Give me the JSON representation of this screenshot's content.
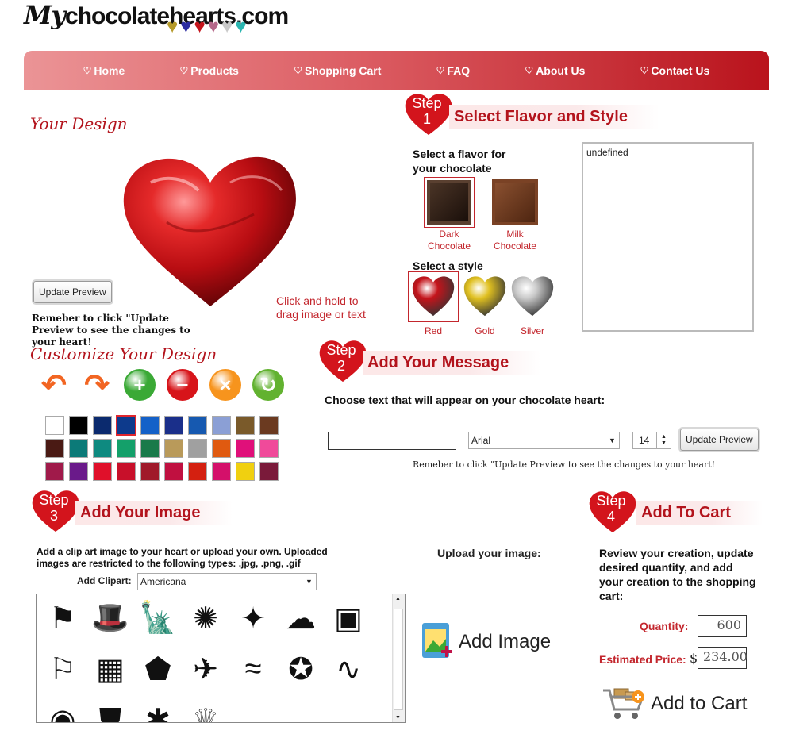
{
  "header": {
    "logo_prefix": "My",
    "logo_text": "chocolatehearts.com",
    "logo_hearts": [
      "#b59a2a",
      "#2c2ca0",
      "#c4141b",
      "#b5688a",
      "#c8c8c8",
      "#2bb5b0"
    ]
  },
  "nav": {
    "items": [
      {
        "label": "Home",
        "icon": "heart-icon"
      },
      {
        "label": "Products",
        "icon": "heart-icon"
      },
      {
        "label": "Shopping Cart",
        "icon": "heart-icon"
      },
      {
        "label": "FAQ",
        "icon": "heart-icon"
      },
      {
        "label": "About Us",
        "icon": "heart-icon"
      },
      {
        "label": "Contact Us",
        "icon": "heart-icon"
      }
    ]
  },
  "design": {
    "title": "Your Design",
    "update_button": "Update Preview",
    "reminder": "Remeber to click \"Update Preview to see the changes to your heart!",
    "drag_hint": "Click and hold to drag image or text"
  },
  "customize": {
    "title": "Customize Your Design",
    "tools": [
      {
        "icon": "rotate-left-icon",
        "color": "#f26522"
      },
      {
        "icon": "rotate-right-icon",
        "color": "#f26522"
      },
      {
        "icon": "zoom-in-icon",
        "color": "#3aa935"
      },
      {
        "icon": "zoom-out-icon",
        "color": "#d7141a"
      },
      {
        "icon": "delete-icon",
        "color": "#f7941d"
      },
      {
        "icon": "refresh-icon",
        "color": "#62b230"
      }
    ],
    "swatches": [
      "#ffffff",
      "#000000",
      "#0b2a6e",
      "#0d3a8c",
      "#1461c8",
      "#1a2f8a",
      "#1659b0",
      "#8b9fd5",
      "#7a5a2a",
      "#6b3a20",
      "#4a1a14",
      "#0c7a78",
      "#0e8a80",
      "#14a06a",
      "#1a7a4a",
      "#b99a5a",
      "#a0a0a0",
      "#e05a10",
      "#e0107a",
      "#f04a9a",
      "#a01a4a",
      "#6a1a8a",
      "#e0102a",
      "#c8102a",
      "#a01a2a",
      "#c01040",
      "#d42010",
      "#d4106a",
      "#f0d010",
      "#7a1a3a"
    ],
    "selected_swatch": 3
  },
  "step1": {
    "step_word": "Step",
    "number": "1",
    "title": "Select Flavor and Style",
    "flavor_prompt": "Select a flavor for your chocolate",
    "flavors": [
      {
        "label": "Dark Chocolate",
        "color": "#2a1a12"
      },
      {
        "label": "Milk Chocolate",
        "color": "#6e3b1c"
      }
    ],
    "style_prompt": "Select a style",
    "styles": [
      {
        "label": "Red",
        "color": "#c4141b"
      },
      {
        "label": "Gold",
        "color": "#e0c020"
      },
      {
        "label": "Silver",
        "color": "#c8c8c8"
      }
    ],
    "textarea_value": "undefined"
  },
  "step2": {
    "step_word": "Step",
    "number": "2",
    "title": "Add Your Message",
    "prompt": "Choose text that will appear on your chocolate heart:",
    "text_value": "",
    "font": "Arial",
    "font_size": "14",
    "update_button": "Update Preview",
    "reminder": "Remeber to click \"Update Preview to see the changes to your heart!"
  },
  "step3": {
    "step_word": "Step",
    "number": "3",
    "title": "Add Your Image",
    "description": "Add a clip art image to your heart or upload your own. Uploaded images are restricted to the following types: .jpg, .png, .gif",
    "clipart_label": "Add Clipart:",
    "clipart_value": "Americana",
    "upload_label": "Upload your image:",
    "add_image_label": "Add Image",
    "clips": [
      {
        "name": "flag-wavy-clip",
        "glyph": "⚑"
      },
      {
        "name": "uncle-sam-hat-clip",
        "glyph": "🎩"
      },
      {
        "name": "statue-liberty-clip",
        "glyph": "🗽"
      },
      {
        "name": "fireworks-clip",
        "glyph": "✺"
      },
      {
        "name": "firecracker-clip",
        "glyph": "✦"
      },
      {
        "name": "balloons-clip",
        "glyph": "☁"
      },
      {
        "name": "declaration-clip",
        "glyph": "▣"
      },
      {
        "name": "flag-clip",
        "glyph": "⚐"
      },
      {
        "name": "usa-flag-map-clip",
        "glyph": "▦"
      },
      {
        "name": "usa-map-clip",
        "glyph": "⬟"
      },
      {
        "name": "eagle-clip",
        "glyph": "✈"
      },
      {
        "name": "flag-ribbon-clip",
        "glyph": "≈"
      },
      {
        "name": "star-circle-clip",
        "glyph": "✪"
      },
      {
        "name": "ribbon-clip",
        "glyph": "∿"
      },
      {
        "name": "seal-clip",
        "glyph": "◉"
      },
      {
        "name": "route-66-clip",
        "glyph": "⛊"
      },
      {
        "name": "tennessee-clip",
        "glyph": "✱"
      },
      {
        "name": "liberty-crown-clip",
        "glyph": "♕"
      }
    ]
  },
  "step4": {
    "step_word": "Step",
    "number": "4",
    "title": "Add To Cart",
    "description": "Review your creation, update desired quantity, and add your creation to the shopping cart:",
    "quantity_label": "Quantity:",
    "quantity": "600",
    "price_label": "Estimated Price:",
    "currency": "$",
    "price": "234.00",
    "add_to_cart": "Add to Cart"
  }
}
